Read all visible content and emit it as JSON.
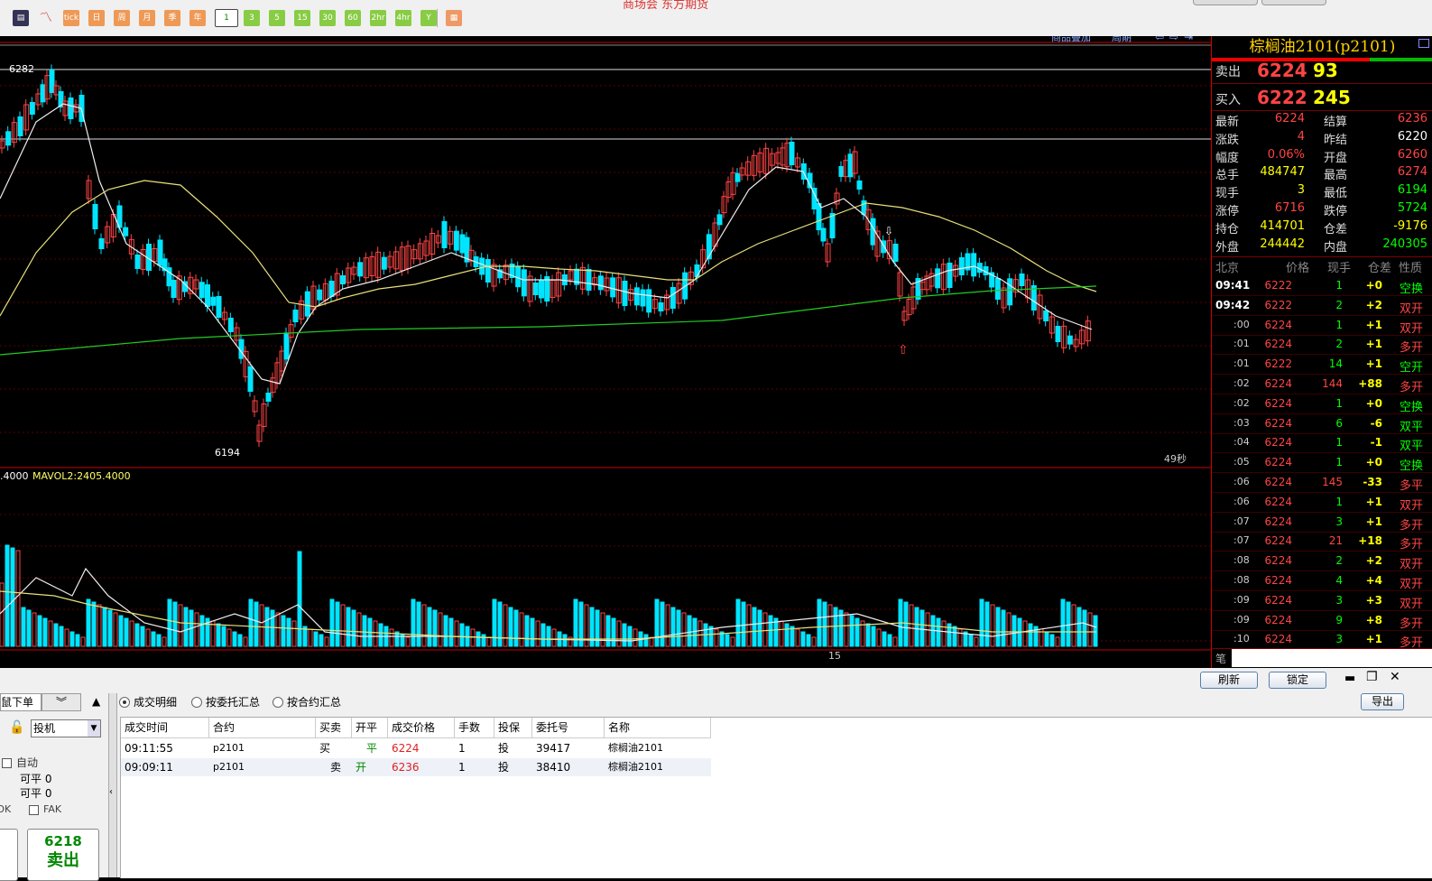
{
  "toolbar": {
    "title": "商场会 东方期货",
    "buttons": [
      "tick",
      "日",
      "周",
      "月",
      "季",
      "年",
      "1",
      "3",
      "5",
      "15",
      "30",
      "60",
      "2hr",
      "4hr",
      "Y"
    ]
  },
  "chart": {
    "overlay_label": "商品叠加",
    "period_label": "周期",
    "high_label": "6282",
    "low_label": "6194",
    "countdown": "49秒",
    "vol_label": ".4000",
    "mavol_label": "MAVOL2:2405.4000",
    "x_tick": "15"
  },
  "quote": {
    "title": "棕榈油2101(p2101)",
    "sell_label": "卖出",
    "sell_price": "6224",
    "sell_vol": "93",
    "buy_label": "买入",
    "buy_price": "6222",
    "buy_vol": "245",
    "stats": [
      {
        "l": "最新",
        "v": "6224",
        "c": "#ff4444",
        "l2": "结算",
        "v2": "6236",
        "c2": "#ff4444"
      },
      {
        "l": "涨跌",
        "v": "4",
        "c": "#ff4444",
        "l2": "昨结",
        "v2": "6220",
        "c2": "#ffffff"
      },
      {
        "l": "幅度",
        "v": "0.06%",
        "c": "#ff4444",
        "l2": "开盘",
        "v2": "6260",
        "c2": "#ff4444"
      },
      {
        "l": "总手",
        "v": "484747",
        "c": "#ffff00",
        "l2": "最高",
        "v2": "6274",
        "c2": "#ff4444"
      },
      {
        "l": "现手",
        "v": "3",
        "c": "#ffff00",
        "l2": "最低",
        "v2": "6194",
        "c2": "#00ff00"
      },
      {
        "l": "涨停",
        "v": "6716",
        "c": "#ff4444",
        "l2": "跌停",
        "v2": "5724",
        "c2": "#00ff00"
      },
      {
        "l": "持仓",
        "v": "414701",
        "c": "#ffff00",
        "l2": "仓差",
        "v2": "-9176",
        "c2": "#ffff00"
      },
      {
        "l": "外盘",
        "v": "244442",
        "c": "#ffff00",
        "l2": "内盘",
        "v2": "240305",
        "c2": "#00ff00"
      }
    ],
    "ticks_header": [
      "北京",
      "价格",
      "现手",
      "仓差",
      "性质"
    ],
    "ticks": [
      {
        "t": "09:41",
        "p": "6222",
        "v": "1",
        "d": "+0",
        "n": "空换",
        "nc": "#00ff00"
      },
      {
        "t": "09:42",
        "p": "6222",
        "v": "2",
        "d": "+2",
        "n": "双开",
        "nc": "#ff4444"
      },
      {
        "t": ":00",
        "p": "6224",
        "v": "1",
        "d": "+1",
        "n": "双开",
        "nc": "#ff4444"
      },
      {
        "t": ":01",
        "p": "6224",
        "v": "2",
        "d": "+1",
        "n": "多开",
        "nc": "#ff4444"
      },
      {
        "t": ":01",
        "p": "6222",
        "v": "14",
        "d": "+1",
        "n": "空开",
        "nc": "#00ff00"
      },
      {
        "t": ":02",
        "p": "6224",
        "v": "144",
        "d": "+88",
        "n": "多开",
        "nc": "#ff4444"
      },
      {
        "t": ":02",
        "p": "6224",
        "v": "1",
        "d": "+0",
        "n": "空换",
        "nc": "#00ff00"
      },
      {
        "t": ":03",
        "p": "6224",
        "v": "6",
        "d": "-6",
        "n": "双平",
        "nc": "#00ff00"
      },
      {
        "t": ":04",
        "p": "6224",
        "v": "1",
        "d": "-1",
        "n": "双平",
        "nc": "#00ff00"
      },
      {
        "t": ":05",
        "p": "6224",
        "v": "1",
        "d": "+0",
        "n": "空换",
        "nc": "#00ff00"
      },
      {
        "t": ":06",
        "p": "6224",
        "v": "145",
        "d": "-33",
        "n": "多平",
        "nc": "#ff4444"
      },
      {
        "t": ":06",
        "p": "6224",
        "v": "1",
        "d": "+1",
        "n": "双开",
        "nc": "#ff4444"
      },
      {
        "t": ":07",
        "p": "6224",
        "v": "3",
        "d": "+1",
        "n": "多开",
        "nc": "#ff4444"
      },
      {
        "t": ":07",
        "p": "6224",
        "v": "21",
        "d": "+18",
        "n": "多开",
        "nc": "#ff4444"
      },
      {
        "t": ":08",
        "p": "6224",
        "v": "2",
        "d": "+2",
        "n": "双开",
        "nc": "#ff4444"
      },
      {
        "t": ":08",
        "p": "6224",
        "v": "4",
        "d": "+4",
        "n": "双开",
        "nc": "#ff4444"
      },
      {
        "t": ":09",
        "p": "6224",
        "v": "3",
        "d": "+3",
        "n": "双开",
        "nc": "#ff4444"
      },
      {
        "t": ":09",
        "p": "6224",
        "v": "9",
        "d": "+8",
        "n": "多开",
        "nc": "#ff4444"
      },
      {
        "t": ":10",
        "p": "6224",
        "v": "3",
        "d": "+1",
        "n": "多开",
        "nc": "#ff4444"
      }
    ],
    "footer": "笔"
  },
  "bottom": {
    "refresh": "刷新",
    "lock": "锁定",
    "export": "导出",
    "left_tab": "鼠下单",
    "account_type": "投机",
    "auto_label": "自动",
    "close_avail_1": "可平 0",
    "close_avail_2": "可平 0",
    "fok": "FOK",
    "fak": "FAK",
    "price_box": "6218",
    "price_box_action": "卖出",
    "radios": [
      "成交明细",
      "按委托汇总",
      "按合约汇总"
    ],
    "headers": [
      "成交时间",
      "合约",
      "买卖",
      "开平",
      "成交价格",
      "手数",
      "投保",
      "委托号",
      "名称"
    ],
    "rows": [
      {
        "time": "09:11:55",
        "contract": "p2101",
        "bs": "买",
        "oc": "平",
        "price": "6224",
        "qty": "1",
        "hedge": "投",
        "order": "39417",
        "name": "棕榈油2101"
      },
      {
        "time": "09:09:11",
        "contract": "p2101",
        "bs": "卖",
        "oc": "开",
        "price": "6236",
        "qty": "1",
        "hedge": "投",
        "order": "38410",
        "name": "棕榈油2101"
      }
    ]
  }
}
